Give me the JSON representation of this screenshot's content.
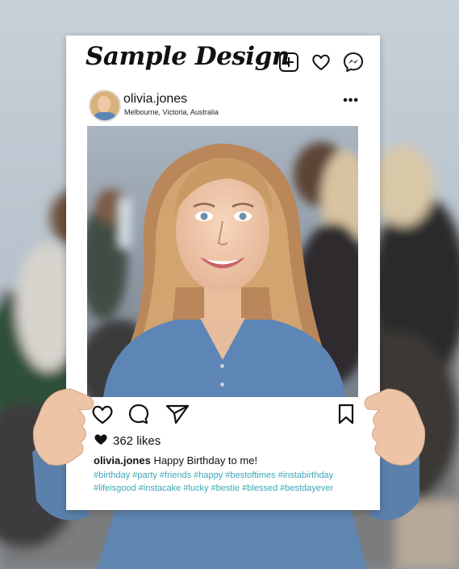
{
  "post": {
    "brand_title": "Sample Design",
    "username": "olivia.jones",
    "location": "Melbourne, Victoria, Australia",
    "likes": "362 likes",
    "caption_user": "olivia.jones",
    "caption_text": "Happy Birthday to me!",
    "hashtags_line1": "#birthday #party #friends #happy #bestoftimes #instabirthday",
    "hashtags_line2": "#lifeisgood #instacake #lucky #bestie #blessed #bestdayever"
  },
  "icons": {
    "top": [
      "add-post-icon",
      "heart-icon",
      "messenger-icon"
    ],
    "actions": [
      "like-icon",
      "comment-icon",
      "share-icon",
      "bookmark-icon"
    ]
  },
  "colors": {
    "hashtag": "#3aa7b8",
    "frame": "#ffffff"
  }
}
